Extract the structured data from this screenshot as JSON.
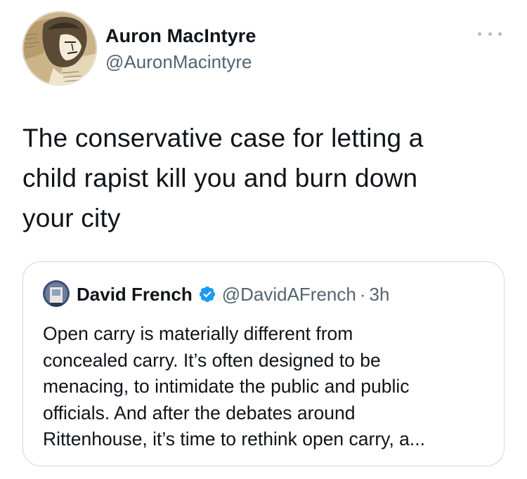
{
  "tweet": {
    "author_name": "Auron MacIntyre",
    "author_handle": "@AuronMacintyre",
    "text": "The conservative case for letting a\nchild rapist kill you and burn down\nyour city"
  },
  "quoted_tweet": {
    "author_name": "David French",
    "author_handle": "@DavidAFrench",
    "separator": "·",
    "time": "3h",
    "verified": true,
    "text": "Open carry is materially different from\nconcealed carry. It’s often designed to be\nmenacing, to intimidate the public and public\nofficials. And after the debates around\nRittenhouse, it’s time to rethink open carry, a..."
  },
  "icons": {
    "more": "more-horizontal-icon",
    "verified": "verified-badge-icon"
  },
  "colors": {
    "text": "#0f1419",
    "secondary": "#536471",
    "verified": "#1d9bf0",
    "border": "#cfd9de"
  }
}
